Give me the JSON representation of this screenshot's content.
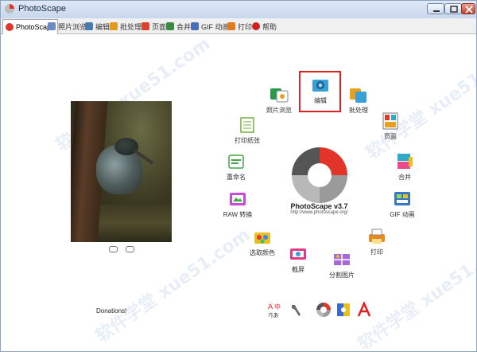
{
  "window": {
    "title": "PhotoScape"
  },
  "tabs": [
    {
      "label": "PhotoScape",
      "icon": "photoscape-icon",
      "color": "#e2352a",
      "active": true
    },
    {
      "label": "照片浏览",
      "icon": "viewer-icon",
      "color": "#6a8ac8"
    },
    {
      "label": "编辑",
      "icon": "editor-icon",
      "color": "#4a7ab0"
    },
    {
      "label": "批处理",
      "icon": "batch-icon",
      "color": "#e09a20"
    },
    {
      "label": "页面",
      "icon": "page-icon",
      "color": "#d8442c"
    },
    {
      "label": "合并",
      "icon": "combine-icon",
      "color": "#3a8a40"
    },
    {
      "label": "GIF 动画",
      "icon": "gif-icon",
      "color": "#4a70b8"
    },
    {
      "label": "打印",
      "icon": "print-icon",
      "color": "#e07a20"
    },
    {
      "label": "帮助",
      "icon": "help-icon",
      "color": "#d02020"
    }
  ],
  "center": {
    "title": "PhotoScape v3.7",
    "url": "http://www.photoscape.org/",
    "colors": {
      "red": "#e2352a",
      "gray": "#9a9a9a",
      "dark": "#555555"
    }
  },
  "menu": [
    {
      "label": "编辑",
      "icon": "editor-icon",
      "color": "#3aa0d8",
      "selected": true
    },
    {
      "label": "批处理",
      "icon": "batch-editor-icon",
      "color": "#e8a020"
    },
    {
      "label": "页面",
      "icon": "page-icon",
      "color": "#d83a2c"
    },
    {
      "label": "合并",
      "icon": "combine-icon",
      "color": "#30a8c8"
    },
    {
      "label": "GIF 动画",
      "icon": "gif-animation-icon",
      "color": "#3878c8"
    },
    {
      "label": "打印",
      "icon": "print-icon",
      "color": "#e88a20"
    },
    {
      "label": "分割图片",
      "icon": "splitter-icon",
      "color": "#a86ad8"
    },
    {
      "label": "截屏",
      "icon": "screen-capture-icon",
      "color": "#e23a8a"
    },
    {
      "label": "选取颜色",
      "icon": "color-picker-icon",
      "color": "#e8c020"
    },
    {
      "label": "RAW 转换",
      "icon": "raw-converter-icon",
      "color": "#c84ad8"
    },
    {
      "label": "重命名",
      "icon": "rename-icon",
      "color": "#40a848"
    },
    {
      "label": "打印纸张",
      "icon": "paper-print-icon",
      "color": "#70b040"
    },
    {
      "label": "照片浏览",
      "icon": "viewer-icon",
      "color": "#2a9a4a"
    }
  ],
  "left": {
    "donations": "Donations!"
  },
  "tools": [
    {
      "icon": "language-icon",
      "color": "#e02020"
    },
    {
      "icon": "wrench-icon",
      "color": "#6a6a6a"
    },
    {
      "icon": "photoscape-logo-icon",
      "color": "#e2352a"
    },
    {
      "icon": "face-search-icon",
      "color": "#3a6ad0"
    },
    {
      "icon": "font-icon",
      "color": "#e02020"
    }
  ],
  "watermark": "软件学堂 xue51.com"
}
